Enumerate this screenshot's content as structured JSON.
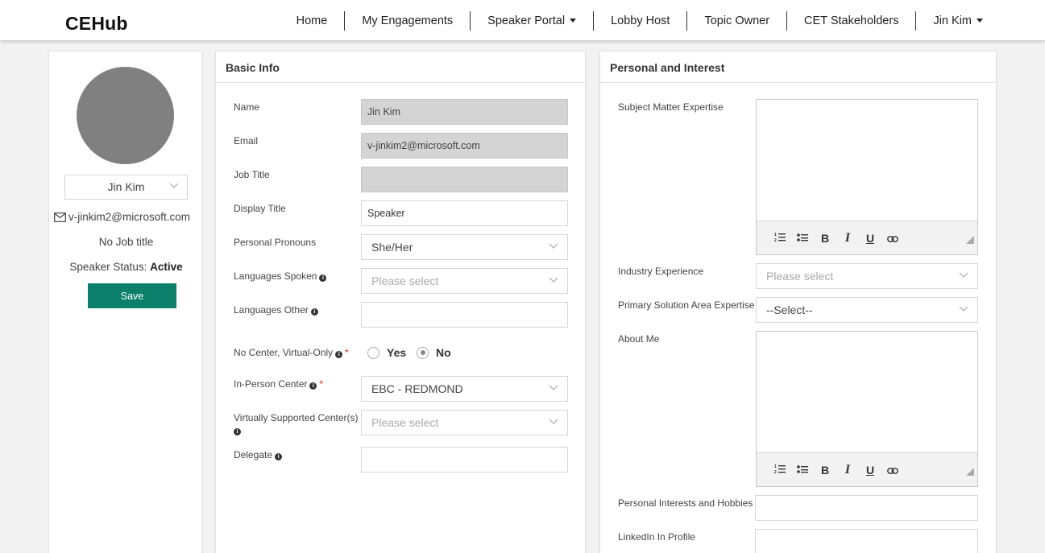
{
  "app": {
    "brand": "CEHub"
  },
  "nav": {
    "items": [
      {
        "label": "Home",
        "dropdown": false
      },
      {
        "label": "My Engagements",
        "dropdown": false
      },
      {
        "label": "Speaker Portal",
        "dropdown": true
      },
      {
        "label": "Lobby Host",
        "dropdown": false
      },
      {
        "label": "Topic Owner",
        "dropdown": false
      },
      {
        "label": "CET Stakeholders",
        "dropdown": false
      },
      {
        "label": "Jin Kim",
        "dropdown": true
      }
    ]
  },
  "profile": {
    "name_select": "Jin Kim",
    "email": "v-jinkim2@microsoft.com",
    "job_title": "No Job title",
    "status_label": "Speaker Status:",
    "status_value": "Active",
    "save_label": "Save",
    "save_color": "#0b7f6a",
    "avatar_color": "#808080"
  },
  "basic": {
    "header": "Basic Info",
    "name_label": "Name",
    "name_value": "Jin Kim",
    "email_label": "Email",
    "email_value": "v-jinkim2@microsoft.com",
    "job_title_label": "Job Title",
    "job_title_value": "",
    "display_title_label": "Display Title",
    "display_title_value": "Speaker",
    "pronouns_label": "Personal Pronouns",
    "pronouns_value": "She/Her",
    "languages_label": "Languages Spoken",
    "languages_placeholder": "Please select",
    "languages_other_label": "Languages Other",
    "languages_other_value": "",
    "no_center_label": "No Center, Virtual-Only",
    "yes_label": "Yes",
    "no_label": "No",
    "no_center_selected": "No",
    "in_person_label": "In-Person Center",
    "in_person_value": "EBC - REDMOND",
    "virtual_centers_label": "Virtually Supported Center(s)",
    "virtual_centers_placeholder": "Please select",
    "delegate_label": "Delegate",
    "delegate_value": ""
  },
  "personal": {
    "header": "Personal and Interest",
    "sme_label": "Subject Matter Expertise",
    "industry_label": "Industry Experience",
    "industry_placeholder": "Please select",
    "primary_area_label": "Primary Solution Area Expertise",
    "primary_area_value": "--Select--",
    "about_label": "About Me",
    "hobbies_label": "Personal Interests and Hobbies",
    "hobbies_value": "",
    "linkedin_label": "LinkedIn In Profile",
    "linkedin_value": ""
  },
  "toolbar": {
    "buttons": [
      "ordered-list-icon",
      "bullet-list-icon",
      "bold-icon",
      "italic-icon",
      "underline-icon",
      "link-icon"
    ],
    "bold": "B",
    "italic": "I",
    "underline": "U"
  }
}
